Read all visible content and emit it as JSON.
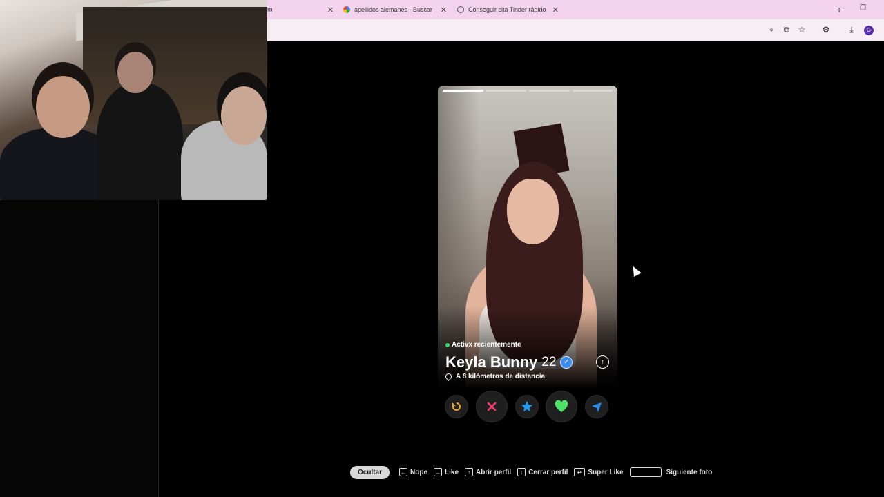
{
  "browser": {
    "tabs": [
      {
        "title": "m",
        "favicon": "generic-icon"
      },
      {
        "title": "apellidos alemanes - Buscar co",
        "favicon": "google-icon"
      },
      {
        "title": "Conseguir cita Tinder rápido",
        "favicon": "globe-icon"
      }
    ],
    "new_tab_label": "+",
    "window_controls": [
      "—",
      "❐"
    ],
    "avatar_letter": "G"
  },
  "profile": {
    "activity": "Activx recientemente",
    "name": "Keyla Bunny",
    "age": "22",
    "distance": "A 8 kilómetros de distancia",
    "photo_count": 4,
    "active_photo": 0
  },
  "actions": [
    {
      "name": "rewind",
      "icon": "rewind-icon",
      "color": "#f4a623"
    },
    {
      "name": "nope",
      "icon": "x-icon",
      "color": "#fe3c72"
    },
    {
      "name": "super-like",
      "icon": "star-icon",
      "color": "#1e9bf0"
    },
    {
      "name": "like",
      "icon": "heart-icon",
      "color": "#4ee06a"
    },
    {
      "name": "boost",
      "icon": "send-icon",
      "color": "#2d8cf0"
    }
  ],
  "shortcuts": {
    "hide": "Ocultar",
    "nope": "Nope",
    "like": "Like",
    "open_profile": "Abrir perfil",
    "close_profile": "Cerrar perfil",
    "super_like": "Super Like",
    "next_photo": "Siguiente foto"
  }
}
